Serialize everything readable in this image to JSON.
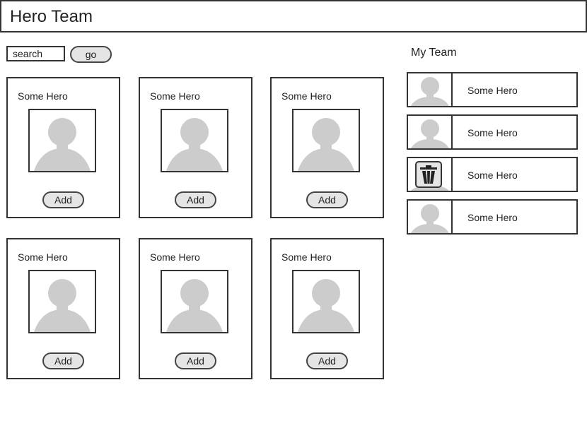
{
  "header": {
    "title": "Hero Team"
  },
  "search": {
    "placeholder": "search",
    "go_label": "go"
  },
  "heroes": [
    {
      "name": "Some Hero",
      "add_label": "Add"
    },
    {
      "name": "Some Hero",
      "add_label": "Add"
    },
    {
      "name": "Some Hero",
      "add_label": "Add"
    },
    {
      "name": "Some Hero",
      "add_label": "Add"
    },
    {
      "name": "Some Hero",
      "add_label": "Add"
    },
    {
      "name": "Some Hero",
      "add_label": "Add"
    }
  ],
  "team": {
    "title": "My Team",
    "members": [
      {
        "name": "Some Hero",
        "icon": "avatar-icon"
      },
      {
        "name": "Some Hero",
        "icon": "avatar-icon"
      },
      {
        "name": "Some Hero",
        "icon": "trash-icon"
      },
      {
        "name": "Some Hero",
        "icon": "avatar-icon"
      }
    ]
  },
  "colors": {
    "border": "#333333",
    "button_fill": "#e5e5e5",
    "placeholder_gray": "#cccccc"
  }
}
